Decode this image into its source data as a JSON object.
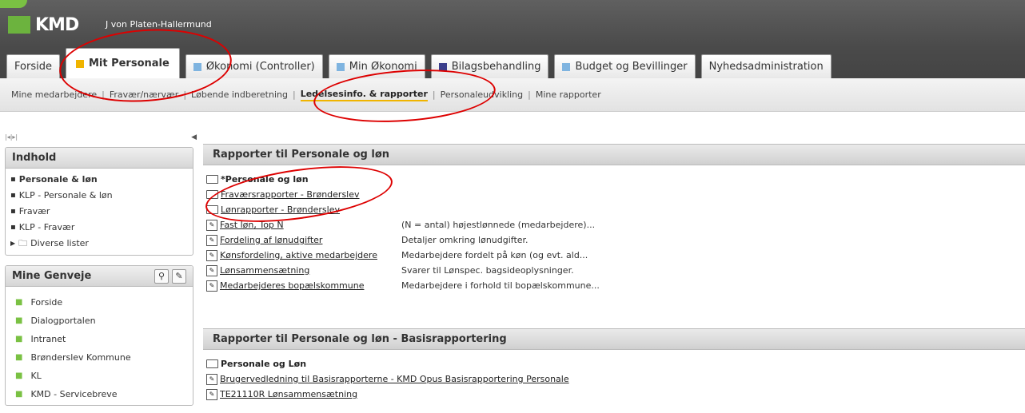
{
  "header": {
    "logo": "KMD",
    "user": "J von Platen-Hallermund"
  },
  "tabs": [
    {
      "label": "Forside",
      "color": ""
    },
    {
      "label": "Mit Personale",
      "color": "#f0b400",
      "active": true
    },
    {
      "label": "Økonomi (Controller)",
      "color": "#7fb4e0"
    },
    {
      "label": "Min Økonomi",
      "color": "#7fb4e0"
    },
    {
      "label": "Bilagsbehandling",
      "color": "#3b3f8c"
    },
    {
      "label": "Budget og Bevillinger",
      "color": "#7fb4e0"
    },
    {
      "label": "Nyhedsadministration",
      "color": ""
    }
  ],
  "subnav": [
    "Mine medarbejdere",
    "Fravær/nærvær",
    "Løbende indberetning",
    "Ledelsesinfo. & rapporter",
    "Personaleudvikling",
    "Mine rapporter"
  ],
  "subnav_active": "Ledelsesinfo. & rapporter",
  "indhold": {
    "title": "Indhold",
    "items": [
      "Personale & løn",
      "KLP - Personale & løn",
      "Fravær",
      "KLP - Fravær",
      "Diverse lister"
    ]
  },
  "genveje": {
    "title": "Mine Genveje",
    "items": [
      "Forside",
      "Dialogportalen",
      "Intranet",
      "Brønderslev Kommune",
      "KL",
      "KMD - Servicebreve"
    ]
  },
  "section1": {
    "title": "Rapporter til Personale og løn",
    "folder_title": "*Personale og løn",
    "folders": [
      "Fraværsrapporter - Brønderslev",
      "Lønrapporter - Brønderslev"
    ],
    "reports": [
      {
        "name": "Fast løn, Top N",
        "desc": "(N = antal) højestlønnede (medarbejdere)..."
      },
      {
        "name": "Fordeling af lønudgifter",
        "desc": "Detaljer omkring lønudgifter."
      },
      {
        "name": "Kønsfordeling, aktive medarbejdere",
        "desc": "Medarbejdere fordelt på køn (og evt. ald..."
      },
      {
        "name": "Lønsammensætning",
        "desc": "Svarer til Lønspec. bagsideoplysninger."
      },
      {
        "name": "Medarbejderes bopælskommune",
        "desc": "Medarbejdere i forhold til bopælskommune..."
      }
    ]
  },
  "section2": {
    "title": "Rapporter til Personale og løn - Basisrapportering",
    "folder_title": "Personale og Løn",
    "reports": [
      {
        "name": "Brugervedledning til Basisrapporterne - KMD Opus Basisrapportering Personale"
      },
      {
        "name": "TE21110R Lønsammensætning"
      }
    ]
  }
}
